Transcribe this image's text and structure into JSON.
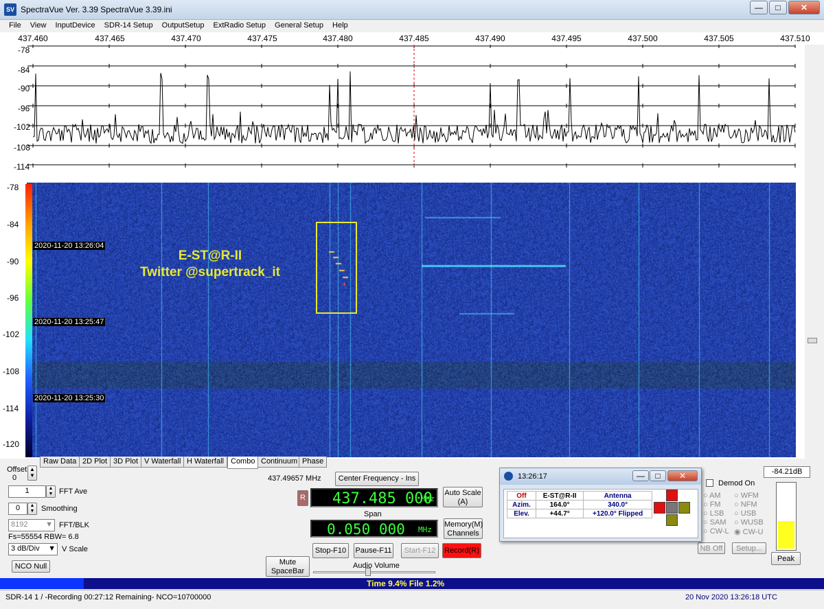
{
  "window": {
    "title": "SpectraVue Ver. 3.39  SpectraVue 3.39.ini",
    "icon_text": "SV",
    "min": "—",
    "max": "□",
    "close": "✕"
  },
  "menu": [
    "File",
    "View",
    "InputDevice",
    "SDR-14 Setup",
    "OutputSetup",
    "ExtRadio Setup",
    "General Setup",
    "Help"
  ],
  "freq_axis": [
    "437.460",
    "437.465",
    "437.470",
    "437.475",
    "437.480",
    "437.485",
    "437.490",
    "437.495",
    "437.500",
    "437.505",
    "437.510"
  ],
  "spectrum_db": [
    "-78",
    "-84",
    "-90",
    "-96",
    "-102",
    "-108",
    "-114"
  ],
  "waterfall_db": [
    "-78",
    "-84",
    "-90",
    "-96",
    "-102",
    "-108",
    "-114",
    "-120"
  ],
  "timestamps": [
    "2020-11-20 13:26:04",
    "2020-11-20 13:25:47",
    "2020-11-20 13:25:30"
  ],
  "annotation": {
    "line1": "E-ST@R-II",
    "line2": "Twitter @supertrack_it"
  },
  "tabs": [
    "Raw Data",
    "2D Plot",
    "3D Plot",
    "V Waterfall",
    "H Waterfall",
    "Combo",
    "Continuum",
    "Phase"
  ],
  "controls": {
    "offset_label": "Offset",
    "offset_value": "0",
    "fft_ave_value": "1",
    "fft_ave_label": "FFT Ave",
    "smoothing_value": "0",
    "smoothing_label": "Smoothing",
    "fft_blk_value": "8192",
    "fft_blk_label": "FFT/BLK",
    "fs_rbw": "Fs=55554 RBW= 6.8",
    "vscale_value": "3 dB/Div",
    "vscale_label": "V Scale",
    "nco_null": "NCO Null",
    "cursor_freq": "437.49657 MHz",
    "center_freq_btn": "Center Frequency - Ins",
    "r_btn": "R",
    "center_freq": "437.485 000",
    "mhz": "MHz",
    "auto_scale": "Auto Scale\n(A)",
    "span_label": "Span",
    "span": "0.050 000",
    "memory": "Memory(M)\nChannels",
    "mute": "Mute\nSpaceBar",
    "stop": "Stop-F10",
    "pause": "Pause-F11",
    "start": "Start-F12",
    "record": "Record(R)",
    "audio_volume": "Audio Volume",
    "demod_on": "Demod On",
    "level": "-84.21dB",
    "peak": "Peak",
    "nb_off": "NB Off",
    "setup": "Setup...",
    "modes_left": [
      "AM",
      "FM",
      "LSB",
      "SAM",
      "CW-L"
    ],
    "modes_right": [
      "WFM",
      "NFM",
      "USB",
      "WUSB",
      "CW-U"
    ]
  },
  "tracker": {
    "time": "13:26:17",
    "headers": [
      "Off",
      "E-ST@R-II",
      "Antenna"
    ],
    "rows": [
      {
        "label": "Azim.",
        "sat": "164.0°",
        "ant": "340.0°"
      },
      {
        "label": "Elev.",
        "sat": "+44.7°",
        "ant": "+120.0° Flipped"
      }
    ]
  },
  "status": {
    "time_file": "Time 9.4%   File 1.2%",
    "left": "SDR-14 1  / -Recording 00:27:12 Remaining-    NCO=10700000",
    "right": "20 Nov 2020  13:26:18 UTC"
  },
  "colors": {
    "lcd_green": "#3cff3c",
    "waterfall_blue": "#1c2f9c",
    "annotation_yellow": "#e8e830",
    "record_red": "#ff1010"
  }
}
